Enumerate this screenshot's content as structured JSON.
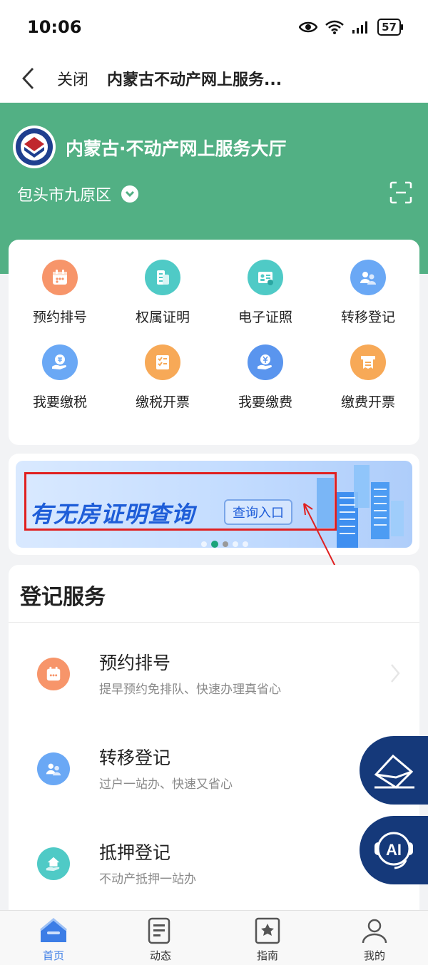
{
  "status_bar": {
    "time": "10:06",
    "battery": "57"
  },
  "nav": {
    "close_label": "关闭",
    "title": "内蒙古不动产网上服务..."
  },
  "hero": {
    "title": "内蒙古·不动产网上服务大厅",
    "region": "包头市九原区"
  },
  "grid": {
    "items": [
      {
        "label": "预约排号",
        "icon": "calendar-icon",
        "color": "#f7956a"
      },
      {
        "label": "权属证明",
        "icon": "building-doc-icon",
        "color": "#4fcac6"
      },
      {
        "label": "电子证照",
        "icon": "id-card-icon",
        "color": "#4fcac6"
      },
      {
        "label": "转移登记",
        "icon": "transfer-users-icon",
        "color": "#6aa8f5"
      },
      {
        "label": "我要缴税",
        "icon": "tax-hand-icon",
        "color": "#6aa8f5"
      },
      {
        "label": "缴税开票",
        "icon": "checklist-icon",
        "color": "#f7a957"
      },
      {
        "label": "我要缴费",
        "icon": "yuan-hand-icon",
        "color": "#5a95ee"
      },
      {
        "label": "缴费开票",
        "icon": "receipt-icon",
        "color": "#f7a957"
      }
    ]
  },
  "banner": {
    "title": "有无房证明查询",
    "button": "查询入口"
  },
  "services": {
    "heading": "登记服务",
    "items": [
      {
        "title": "预约排号",
        "desc": "提早预约免排队、快速办理真省心",
        "icon": "calendar-icon",
        "color": "#f7956a"
      },
      {
        "title": "转移登记",
        "desc": "过户一站办、快速又省心",
        "icon": "transfer-users-icon",
        "color": "#6aa8f5"
      },
      {
        "title": "抵押登记",
        "desc": "不动产抵押一站办",
        "icon": "house-hand-icon",
        "color": "#4fcac6"
      }
    ]
  },
  "float_buttons": {
    "ai_label": "AI"
  },
  "tabs": [
    {
      "label": "首页",
      "active": true
    },
    {
      "label": "动态",
      "active": false
    },
    {
      "label": "指南",
      "active": false
    },
    {
      "label": "我的",
      "active": false
    }
  ],
  "colors": {
    "hero_green": "#52b084",
    "accent_blue": "#3c7de6",
    "float_navy": "#15397a",
    "highlight_red": "#e02020"
  }
}
